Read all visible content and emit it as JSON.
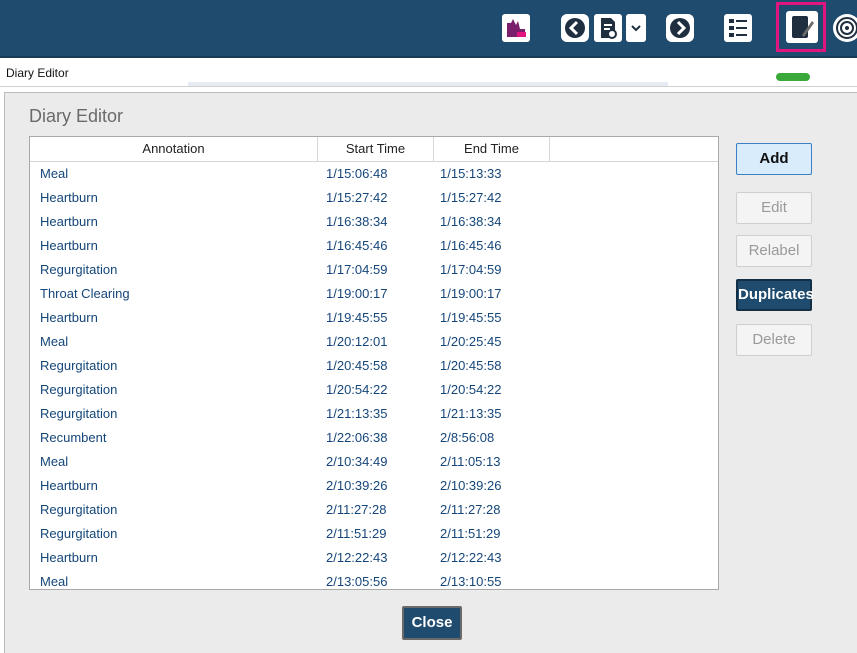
{
  "window": {
    "title": "Diary Editor"
  },
  "toolbar": {
    "icons": [
      "report-icon",
      "previous-icon",
      "document-settings-icon",
      "dropdown-icon",
      "next-icon",
      "checklist-icon",
      "diary-edit-icon",
      "audio-icon"
    ],
    "highlight_color": "#e0157f"
  },
  "dialog": {
    "title": "Diary Editor",
    "columns": {
      "annotation": "Annotation",
      "start_time": "Start Time",
      "end_time": "End Time"
    },
    "rows": [
      {
        "annotation": "Meal",
        "start": "1/15:06:48",
        "end": "1/15:13:33"
      },
      {
        "annotation": "Heartburn",
        "start": "1/15:27:42",
        "end": "1/15:27:42"
      },
      {
        "annotation": "Heartburn",
        "start": "1/16:38:34",
        "end": "1/16:38:34"
      },
      {
        "annotation": "Heartburn",
        "start": "1/16:45:46",
        "end": "1/16:45:46"
      },
      {
        "annotation": "Regurgitation",
        "start": "1/17:04:59",
        "end": "1/17:04:59"
      },
      {
        "annotation": "Throat Clearing",
        "start": "1/19:00:17",
        "end": "1/19:00:17"
      },
      {
        "annotation": "Heartburn",
        "start": "1/19:45:55",
        "end": "1/19:45:55"
      },
      {
        "annotation": "Meal",
        "start": "1/20:12:01",
        "end": "1/20:25:45"
      },
      {
        "annotation": "Regurgitation",
        "start": "1/20:45:58",
        "end": "1/20:45:58"
      },
      {
        "annotation": "Regurgitation",
        "start": "1/20:54:22",
        "end": "1/20:54:22"
      },
      {
        "annotation": "Regurgitation",
        "start": "1/21:13:35",
        "end": "1/21:13:35"
      },
      {
        "annotation": "Recumbent",
        "start": "1/22:06:38",
        "end": "2/8:56:08"
      },
      {
        "annotation": "Meal",
        "start": "2/10:34:49",
        "end": "2/11:05:13"
      },
      {
        "annotation": "Heartburn",
        "start": "2/10:39:26",
        "end": "2/10:39:26"
      },
      {
        "annotation": "Regurgitation",
        "start": "2/11:27:28",
        "end": "2/11:27:28"
      },
      {
        "annotation": "Regurgitation",
        "start": "2/11:51:29",
        "end": "2/11:51:29"
      },
      {
        "annotation": "Heartburn",
        "start": "2/12:22:43",
        "end": "2/12:22:43"
      },
      {
        "annotation": "Meal",
        "start": "2/13:05:56",
        "end": "2/13:10:55"
      }
    ],
    "buttons": {
      "add": "Add",
      "edit": "Edit",
      "relabel": "Relabel",
      "duplicates": "Duplicates",
      "delete": "Delete",
      "close": "Close"
    }
  },
  "colors": {
    "toolbar_bg": "#1f4b6e",
    "row_text": "#15467a",
    "primary_button": "#1f4b6e",
    "status_indicator": "#3aa83a"
  }
}
